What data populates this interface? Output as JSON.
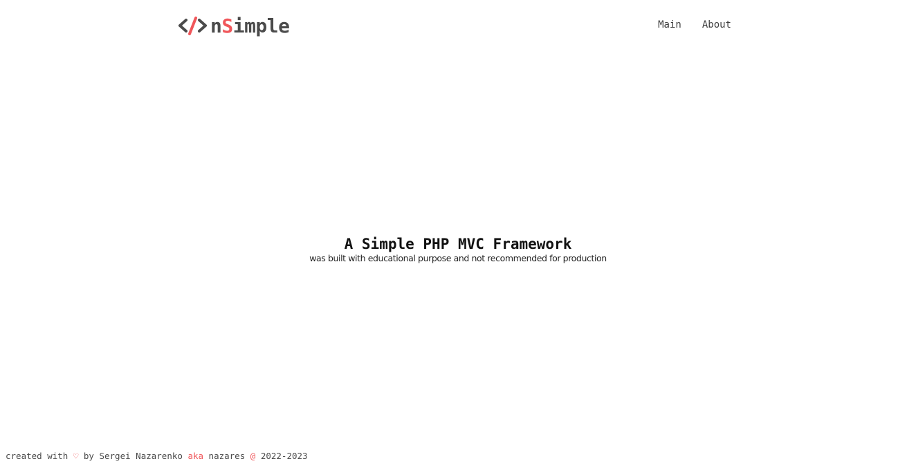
{
  "header": {
    "logo": {
      "icon": "code-slash-icon",
      "part1": "n",
      "part2": "S",
      "part3": "imple"
    },
    "nav": [
      {
        "label": "Main"
      },
      {
        "label": "About"
      }
    ]
  },
  "hero": {
    "title": "A Simple PHP MVC Framework",
    "subtitle": "was built with educational purpose and not recommended for production"
  },
  "footer": {
    "created_with": "created with",
    "heart_icon": "heart-icon",
    "heart_glyph": "♡",
    "by_author": "by Sergei Nazarenko",
    "aka": "aka",
    "nickname": "nazares",
    "at": "@",
    "years": "2022-2023"
  },
  "colors": {
    "accent": "#f0565a",
    "logo_text": "#4b4b4b",
    "text": "#3a3a3a",
    "background": "#ffffff"
  }
}
